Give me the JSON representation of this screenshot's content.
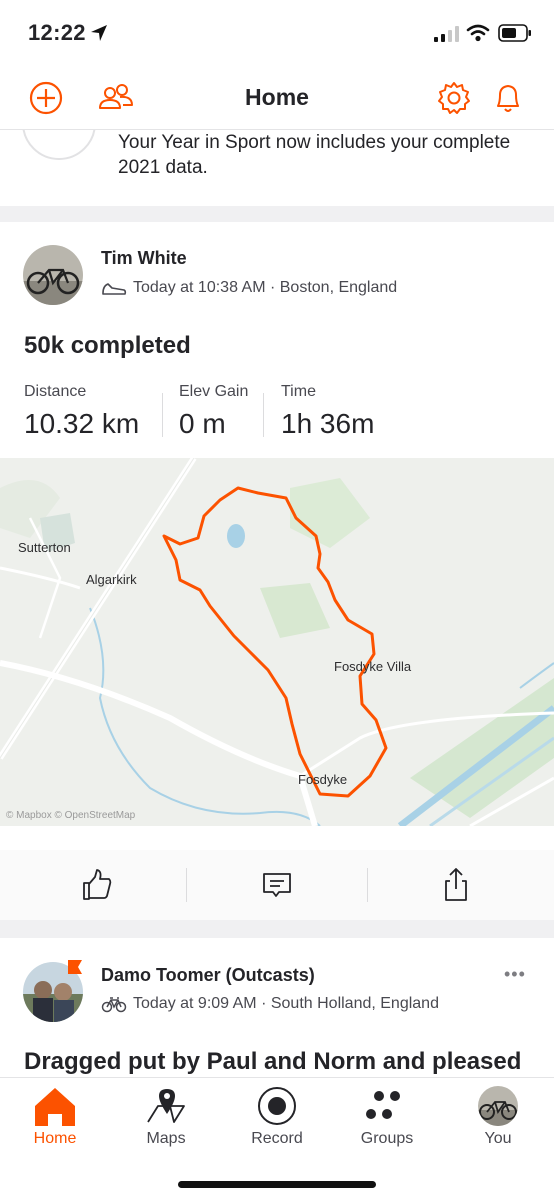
{
  "status_bar": {
    "time": "12:22"
  },
  "header": {
    "title": "Home",
    "icons": [
      "add-icon",
      "people-icon",
      "settings-icon",
      "notifications-icon"
    ]
  },
  "announcement": {
    "text": "Your Year in Sport now includes your complete 2021 data."
  },
  "activity1": {
    "athlete": "Tim White",
    "meta": "Today at 10:38 AM · Boston, England",
    "sport_icon": "shoe-icon",
    "title": "50k completed",
    "stats": [
      {
        "label": "Distance",
        "value": "10.32 km"
      },
      {
        "label": "Elev Gain",
        "value": "0 m"
      },
      {
        "label": "Time",
        "value": "1h 36m"
      }
    ],
    "map": {
      "places": [
        "Sutterton",
        "Algarkirk",
        "Fosdyke Villa",
        "Fosdyke"
      ],
      "attribution": "© Mapbox © OpenStreetMap",
      "route_color": "#fc5200"
    },
    "action_icons": [
      "kudos-icon",
      "comment-icon",
      "share-icon"
    ]
  },
  "activity2": {
    "athlete": "Damo Toomer (Outcasts)",
    "meta": "Today at 9:09 AM · South Holland, England",
    "sport_icon": "bike-icon",
    "title": "Dragged put by Paul and Norm and pleased"
  },
  "tab_bar": {
    "tabs": [
      {
        "label": "Home",
        "icon": "home-icon",
        "active": true
      },
      {
        "label": "Maps",
        "icon": "maps-icon",
        "active": false
      },
      {
        "label": "Record",
        "icon": "record-icon",
        "active": false
      },
      {
        "label": "Groups",
        "icon": "groups-icon",
        "active": false
      },
      {
        "label": "You",
        "icon": "profile-avatar-icon",
        "active": false
      }
    ]
  },
  "colors": {
    "accent": "#fc5200",
    "text": "#242428",
    "muted": "#494950",
    "separator": "#f0f0f2"
  }
}
